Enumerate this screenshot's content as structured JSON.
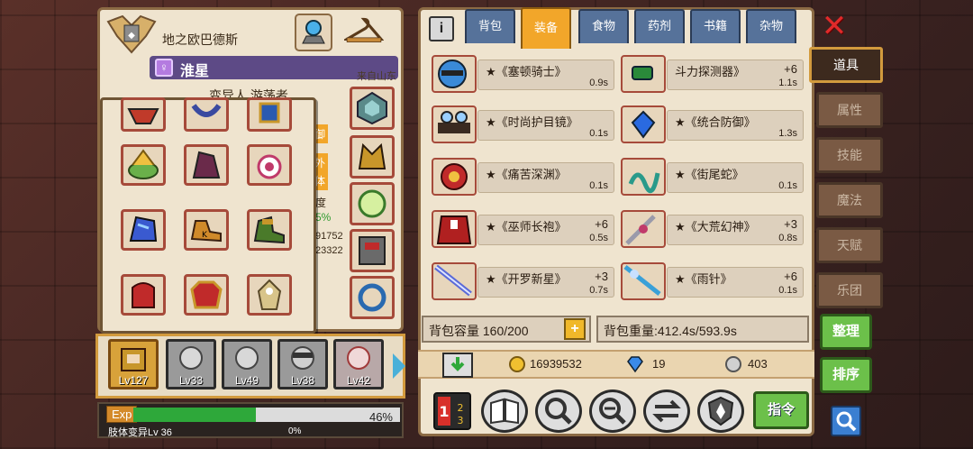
{
  "character": {
    "title": "地之欧巴德斯",
    "hero_name": "淮星",
    "gender_symbol": "♀",
    "origin": "来自山东",
    "subline": "变异人 游荡者",
    "peek_texts": [
      "御",
      "外",
      "体",
      "度",
      "5%",
      "91752",
      "23322"
    ]
  },
  "tabs": [
    {
      "label": "背包",
      "active": false
    },
    {
      "label": "装备",
      "active": true
    },
    {
      "label": "食物",
      "active": false
    },
    {
      "label": "药剂",
      "active": false
    },
    {
      "label": "书籍",
      "active": false
    },
    {
      "label": "杂物",
      "active": false
    }
  ],
  "items": [
    {
      "name": "★《塞顿骑士》",
      "enh": "",
      "weight": "0.9s"
    },
    {
      "name": "斗力探测器》",
      "enh": "+6",
      "weight": "1.1s"
    },
    {
      "name": "★《时尚护目镜》",
      "enh": "",
      "weight": "0.1s"
    },
    {
      "name": "★《统合防御》",
      "enh": "",
      "weight": "1.3s"
    },
    {
      "name": "★《痛苦深渊》",
      "enh": "",
      "weight": "0.1s"
    },
    {
      "name": "★《街尾蛇》",
      "enh": "",
      "weight": "0.1s"
    },
    {
      "name": "★《巫师长袍》",
      "enh": "+6",
      "weight": "0.5s"
    },
    {
      "name": "★《大荒幻神》",
      "enh": "+3",
      "weight": "0.8s"
    },
    {
      "name": "★《开罗新星》",
      "enh": "+3",
      "weight": "0.7s"
    },
    {
      "name": "★《雨针》",
      "enh": "+6",
      "weight": "0.1s"
    }
  ],
  "bag": {
    "capacity_label": "背包容量 160/200",
    "weight_label": "背包重量:412.4s/593.9s",
    "plus_label": "+"
  },
  "currency": {
    "gold": "16939532",
    "diamond": "19",
    "silver": "403"
  },
  "party": [
    {
      "level": "Lv127"
    },
    {
      "level": "Lv33"
    },
    {
      "level": "Lv49"
    },
    {
      "level": "Lv38"
    },
    {
      "level": "Lv42"
    }
  ],
  "exp": {
    "label": "Exp",
    "percent": 46,
    "percent_text": "46%",
    "sub_label": "肢体变异Lv 36",
    "sub_percent": "0%"
  },
  "side_tabs": [
    {
      "label": "道具",
      "active": true
    },
    {
      "label": "属性",
      "active": false
    },
    {
      "label": "技能",
      "active": false
    },
    {
      "label": "魔法",
      "active": false
    },
    {
      "label": "天赋",
      "active": false
    },
    {
      "label": "乐团",
      "active": false
    }
  ],
  "actions": {
    "sort": "整理",
    "order": "排序",
    "command": "指令",
    "info": "i"
  },
  "colors": {
    "accent_orange": "#f2a62a",
    "tab_blue": "#56729a",
    "green_button": "#6cc04a",
    "exp_green": "#2ea83a",
    "close_red": "#e02a2a"
  },
  "icons": [
    "close-icon",
    "info-icon",
    "gold-coin-icon",
    "diamond-icon",
    "silver-coin-icon",
    "book-icon",
    "search-icon",
    "swap-icon",
    "shield-icon",
    "plus-icon",
    "download-icon",
    "number-sort-icon",
    "hanger-icon",
    "crystal-icon",
    "emblem-icon"
  ]
}
